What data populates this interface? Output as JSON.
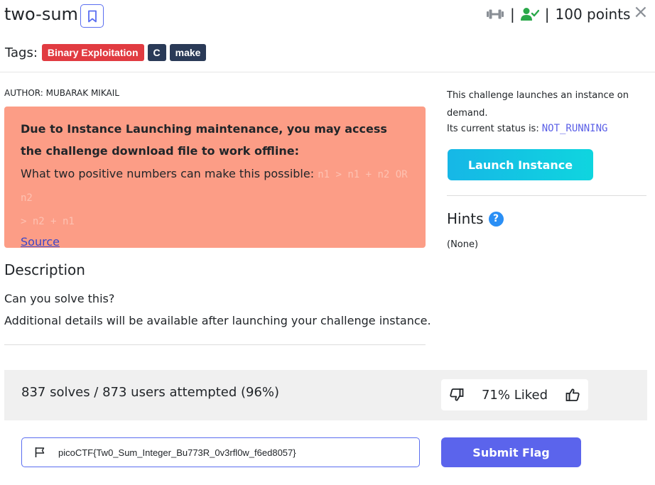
{
  "header": {
    "title": "two-sum",
    "separator": "|",
    "points": "100 points",
    "close_label": "×"
  },
  "tags": {
    "label": "Tags:",
    "items": [
      "Binary Exploitation",
      "C",
      "make"
    ]
  },
  "challenge": {
    "author": "AUTHOR: MUBARAK MIKAIL",
    "alert_heading": "Due to Instance Launching maintenance, you may access the challenge download file to work offline:",
    "alert_question": "What two positive numbers can make this possible:",
    "alert_code_line1": "n1 > n1 + n2 OR n2",
    "alert_code_line2": "> n2 + n1",
    "source_link": "Source"
  },
  "description": {
    "title": "Description",
    "line1": "Can you solve this?",
    "line2": "Additional details will be available after launching your challenge instance."
  },
  "instance": {
    "info": "This challenge launches an instance on demand.",
    "status_label": "Its current status is:",
    "status_value": "NOT_RUNNING",
    "launch_button": "Launch Instance"
  },
  "hints": {
    "title": "Hints",
    "help_glyph": "?",
    "value": "(None)"
  },
  "stats": {
    "solves": "837 solves / 873 users attempted (96%)",
    "liked": "71% Liked"
  },
  "flag": {
    "value": "picoCTF{Tw0_Sum_Integer_Bu773R_0v3rfl0w_f6ed8057}",
    "submit_button": "Submit Flag"
  },
  "icons": {
    "bookmark": "bookmark-icon",
    "difficulty": "dumbbell-icon",
    "solved": "user-check-icon",
    "thumbs_down": "thumbs-down-icon",
    "thumbs_up": "thumbs-up-icon",
    "flag": "flag-icon"
  },
  "colors": {
    "accent": "#5b64ec",
    "alert_bg": "#fc9d86",
    "tag_red": "#e13b41",
    "tag_dark": "#2a3a57",
    "launch_start": "#16b7e6",
    "launch_end": "#0fd5df",
    "solved_green": "#2aa84a",
    "status_value": "#5a5fe6"
  }
}
